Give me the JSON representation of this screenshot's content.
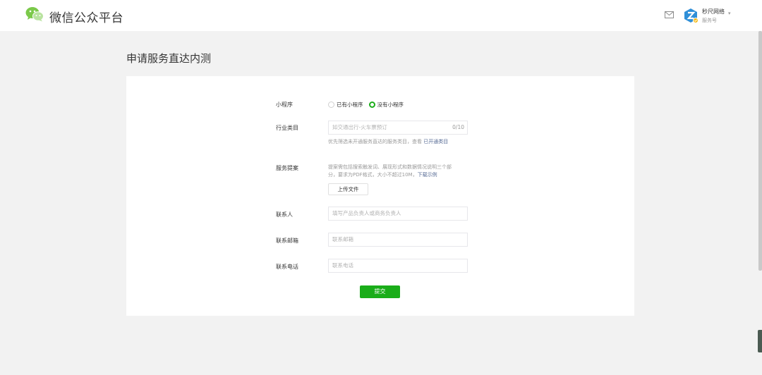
{
  "header": {
    "brand": "微信公众平台",
    "account_name": "秒尺网络",
    "account_type": "服务号"
  },
  "page": {
    "title": "申请服务直达内测"
  },
  "form": {
    "mini_program": {
      "label": "小程序",
      "options": [
        "已有小程序",
        "没有小程序"
      ],
      "selected": "没有小程序"
    },
    "industry": {
      "label": "行业类目",
      "placeholder": "如交通出行-火车票预订",
      "counter": "0/10",
      "hint_prefix": "优先筛选未开通服务直达的服务类目，查看",
      "hint_link": "已开通类目"
    },
    "proposal": {
      "label": "服务提案",
      "hint_line1": "提案需包括搜索触发词、展现形式和数据情况说明三个部",
      "hint_line2_prefix": "分，要求为PDF格式，大小不超过10M，",
      "hint_link": "下载示例",
      "upload_label": "上传文件"
    },
    "contact": {
      "label": "联系人",
      "placeholder": "填写产品负责人或商务负责人"
    },
    "email": {
      "label": "联系邮箱",
      "placeholder": "联系邮箱"
    },
    "phone": {
      "label": "联系电话",
      "placeholder": "联系电话"
    },
    "submit_label": "提交"
  },
  "colors": {
    "accent": "#1aad19",
    "link": "#576b95",
    "background": "#f2f2f2"
  }
}
